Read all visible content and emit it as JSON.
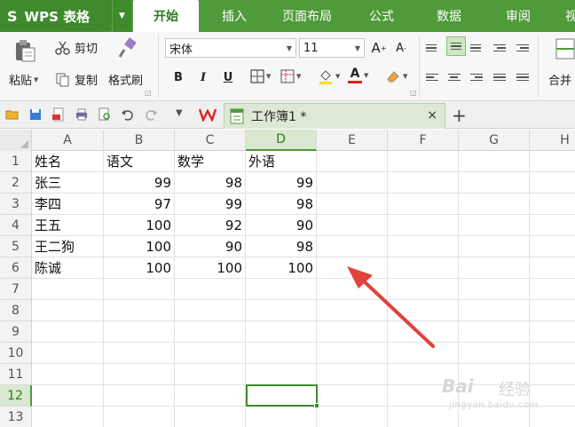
{
  "app": {
    "logo_mark": "S",
    "logo_text": "WPS 表格",
    "logo_caret": "▼"
  },
  "menu_tabs": [
    "开始",
    "插入",
    "页面布局",
    "公式",
    "数据",
    "审阅",
    "视"
  ],
  "ribbon": {
    "paste_label": "粘贴",
    "cut_label": "剪切",
    "copy_label": "复制",
    "format_painter_label": "格式刷",
    "font_name": "宋体",
    "font_size": "11",
    "grow_font": "A",
    "shrink_font": "A",
    "bold": "B",
    "italic": "I",
    "underline": "U",
    "font_color_glyph": "A",
    "merge_label": "合并"
  },
  "document_tab": {
    "title": "工作簿1 *",
    "close": "×",
    "new_tab": "+"
  },
  "sheet": {
    "columns": [
      "A",
      "B",
      "C",
      "D",
      "E",
      "F",
      "G",
      "H"
    ],
    "selected_column": "D",
    "rows": [
      "1",
      "2",
      "3",
      "4",
      "5",
      "6",
      "7",
      "8",
      "9",
      "10",
      "11",
      "12",
      "13"
    ],
    "selected_row": "12",
    "cells": [
      [
        "姓名",
        "语文",
        "数学",
        "外语"
      ],
      [
        "张三",
        "99",
        "98",
        "99"
      ],
      [
        "李四",
        "97",
        "99",
        "98"
      ],
      [
        "王五",
        "100",
        "92",
        "90"
      ],
      [
        "王二狗",
        "100",
        "90",
        "98"
      ],
      [
        "陈诚",
        "100",
        "100",
        "100"
      ]
    ]
  },
  "colors": {
    "menubar": "#4f9a3a",
    "accent": "#3f8a2c",
    "arrow": "#e0433b"
  },
  "watermark": {
    "line1": "Bai",
    "line2": "经验",
    "line3": "jingyan.baidu.com"
  }
}
